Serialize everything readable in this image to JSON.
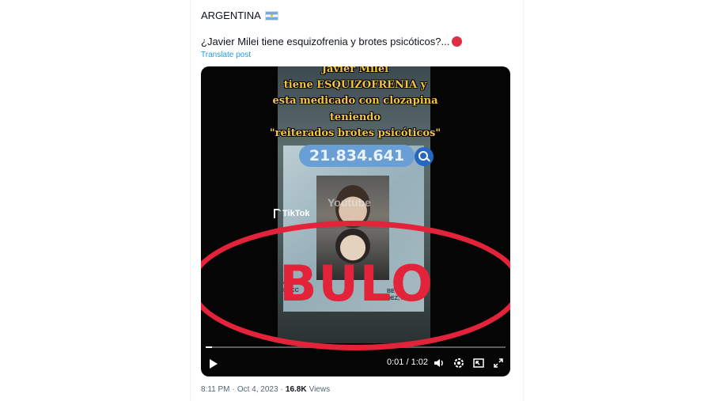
{
  "post": {
    "author": "ARGENTINA",
    "author_flag_icon": "argentina-flag-icon",
    "text": "¿Javier Milei tiene esquizofrenia y brotes psicóticos?...",
    "text_icon": "red-circle-icon",
    "translate_label": "Translate post"
  },
  "video": {
    "overlay_lines": [
      "Javier Milei",
      "tiene ESQUIZOFRENIA  y",
      "esta medicado con clozapina",
      "teniendo",
      "\"reiterados brotes psicóticos\""
    ],
    "dni_number": "21.834.641",
    "watermark_youtube": "Youtube",
    "watermark_tiktok": "TikTok",
    "dni_left_text": "OMB\nRECC",
    "dni_right_text": "BE\nDEZ, PCIA",
    "stamp_text": "BULO",
    "stamp_color": "#e2233a",
    "progress": 0.008,
    "time_display": "0:01 / 1:02",
    "controls": [
      "play-icon",
      "volume-icon",
      "settings-icon",
      "pip-icon",
      "fullscreen-icon"
    ]
  },
  "meta": {
    "time": "8:11 PM",
    "separator": "·",
    "date": "Oct 4, 2023",
    "views_count": "16.8K",
    "views_label": "Views"
  }
}
